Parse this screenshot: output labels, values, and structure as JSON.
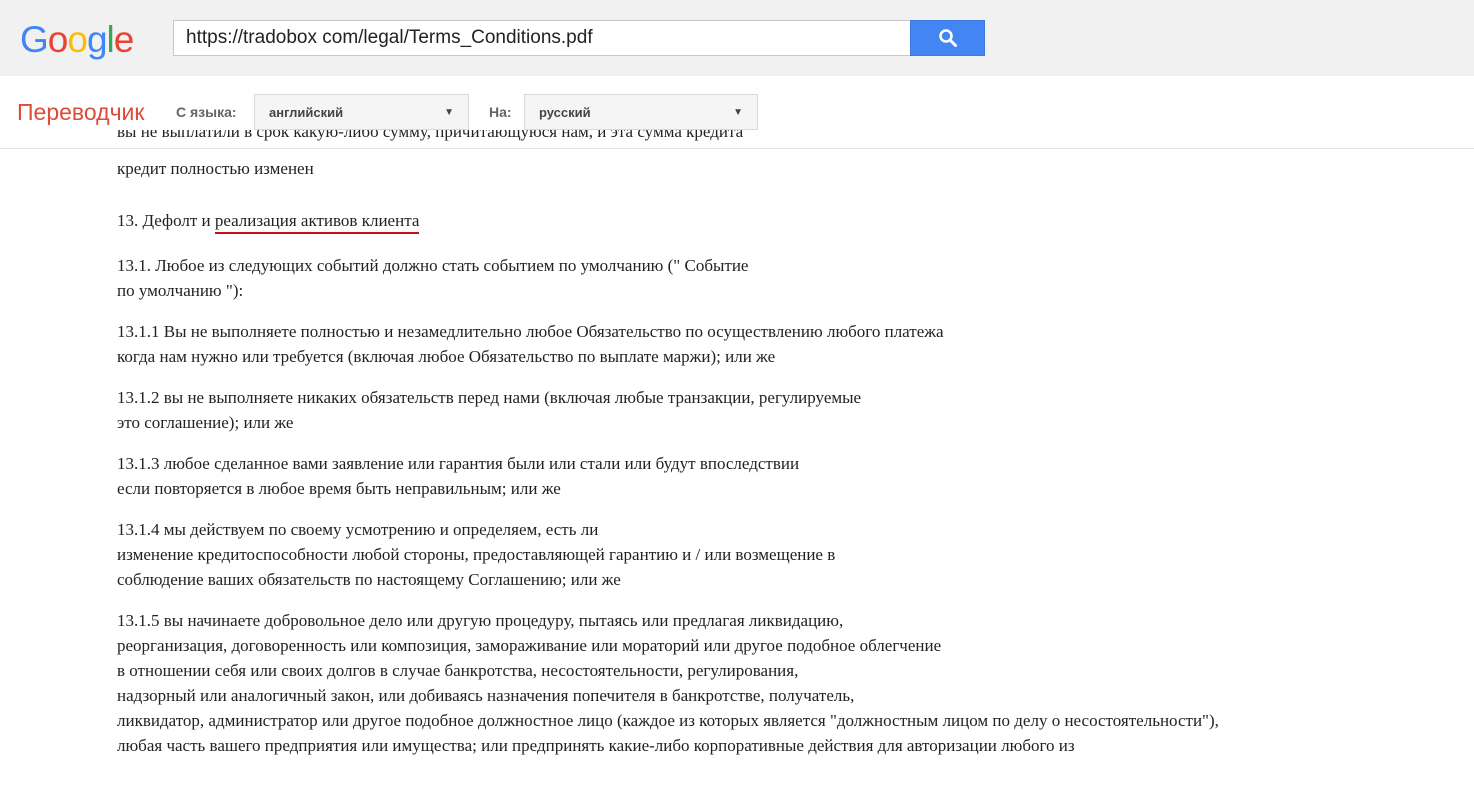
{
  "header": {
    "logo_text": "Google",
    "logo_colors": [
      "#4285f4",
      "#ea4335",
      "#fbbc05",
      "#4285f4",
      "#34a853",
      "#ea4335"
    ],
    "url_value": "https://tradobox com/legal/Terms_Conditions.pdf",
    "search_icon": "search-icon"
  },
  "toolbar": {
    "title": "Переводчик",
    "from_label": "С языка:",
    "from_value": "английский",
    "to_label": "На:",
    "to_value": "русский"
  },
  "document": {
    "cut_line": "вы не выплатили в срок какую-либо сумму, причитающуюся нам, и эта сумма кредита",
    "paragraphs": [
      {
        "lines": [
          "кредит полностью изменен"
        ]
      },
      {
        "lines": [
          "13. Дефолт и ",
          "реализация активов клиента"
        ]
      },
      {
        "lines": [
          "13.1. Любое из следующих событий должно стать событием по умолчанию (\" Событие",
          "по умолчанию \"):"
        ]
      },
      {
        "lines": [
          "13.1.1 Вы не выполняете полностью и незамедлительно любое Обязательство по осуществлению любого платежа",
          "когда нам нужно или требуется (включая любое Обязательство по выплате маржи); или же"
        ]
      },
      {
        "lines": [
          "13.1.2 вы не выполняете никаких обязательств перед нами (включая любые транзакции, регулируемые",
          "это соглашение); или же"
        ]
      },
      {
        "lines": [
          "13.1.3 любое сделанное вами заявление или гарантия были или стали или будут впоследствии",
          "если повторяется в любое время быть неправильным; или же"
        ]
      },
      {
        "lines": [
          "13.1.4 мы действуем по своему усмотрению и определяем, есть ли",
          "изменение кредитоспособности любой стороны, предоставляющей гарантию и / или возмещение в",
          "соблюдение ваших обязательств по настоящему Соглашению; или же"
        ]
      },
      {
        "lines": [
          "13.1.5 вы начинаете добровольное дело или другую процедуру, пытаясь или предлагая ликвидацию,",
          "реорганизация, договоренность или композиция, замораживание или мораторий или другое подобное облегчение",
          "в отношении себя или своих долгов в случае банкротства, несостоятельности, регулирования,",
          "надзорный или аналогичный закон, или добиваясь назначения попечителя в банкротстве, получатель,",
          "ликвидатор, администратор или другое подобное должностное лицо (каждое из которых является \"должностным лицом по делу о несостоятельности\"),",
          "любая часть вашего предприятия или имущества; или предпринять какие-либо корпоративные действия для авторизации любого из"
        ]
      }
    ]
  }
}
